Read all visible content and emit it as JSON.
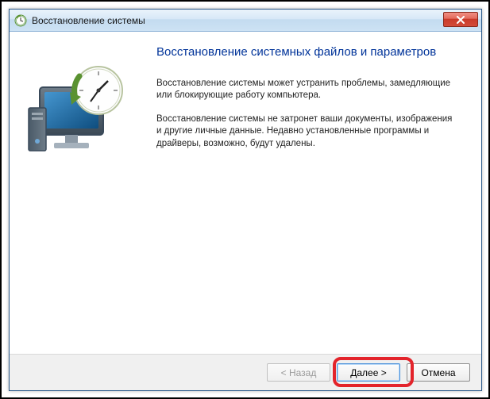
{
  "window": {
    "title": "Восстановление системы"
  },
  "content": {
    "heading": "Восстановление системных файлов и параметров",
    "para1": "Восстановление системы может устранить проблемы, замедляющие или блокирующие работу компьютера.",
    "para2": "Восстановление системы не затронет ваши документы, изображения и другие личные данные. Недавно установленные программы и драйверы, возможно, будут удалены."
  },
  "buttons": {
    "back": "< Назад",
    "next": "Далее >",
    "cancel": "Отмена"
  }
}
